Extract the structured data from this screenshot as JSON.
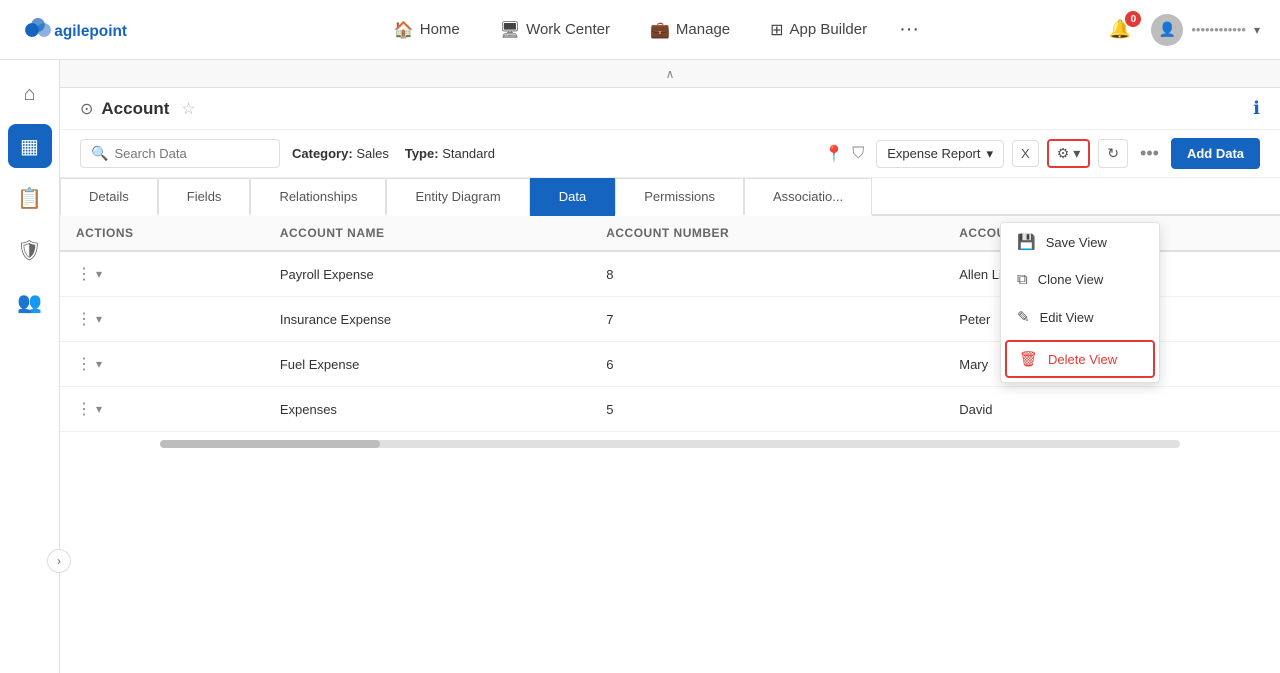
{
  "logo": {
    "alt": "AgilePoint"
  },
  "nav": {
    "items": [
      {
        "id": "home",
        "label": "Home",
        "icon": "🏠"
      },
      {
        "id": "work-center",
        "label": "Work Center",
        "icon": "🖥"
      },
      {
        "id": "manage",
        "label": "Manage",
        "icon": "💼"
      },
      {
        "id": "app-builder",
        "label": "App Builder",
        "icon": "⊞"
      }
    ],
    "more_icon": "···",
    "notification_count": "0",
    "user_name": "••••••••••••"
  },
  "sidebar": {
    "items": [
      {
        "id": "home",
        "icon": "⌂",
        "active": false
      },
      {
        "id": "data",
        "icon": "▦",
        "active": true
      },
      {
        "id": "reports",
        "icon": "📋",
        "active": false
      },
      {
        "id": "shield",
        "icon": "🛡",
        "active": false
      },
      {
        "id": "users",
        "icon": "👥",
        "active": false
      }
    ]
  },
  "page": {
    "back_label": "⊙",
    "title": "Account",
    "info_icon": "ℹ"
  },
  "toolbar": {
    "search_placeholder": "Search Data",
    "category_label": "Category:",
    "category_value": "Sales",
    "type_label": "Type:",
    "type_value": "Standard",
    "view_name": "Expense Report",
    "add_data_label": "Add Data"
  },
  "tabs": [
    {
      "id": "details",
      "label": "Details",
      "active": false
    },
    {
      "id": "fields",
      "label": "Fields",
      "active": false
    },
    {
      "id": "relationships",
      "label": "Relationships",
      "active": false
    },
    {
      "id": "entity-diagram",
      "label": "Entity Diagram",
      "active": false
    },
    {
      "id": "data",
      "label": "Data",
      "active": true
    },
    {
      "id": "permissions",
      "label": "Permissions",
      "active": false
    },
    {
      "id": "associations",
      "label": "Associatio...",
      "active": false
    }
  ],
  "table": {
    "columns": [
      {
        "id": "actions",
        "label": "ACTIONS"
      },
      {
        "id": "account-name",
        "label": "Account Name"
      },
      {
        "id": "account-number",
        "label": "Account Number"
      },
      {
        "id": "account-owner",
        "label": "Account Owner"
      }
    ],
    "rows": [
      {
        "id": 1,
        "account_name": "Payroll Expense",
        "account_number": "8",
        "account_owner": "Allen Lilly"
      },
      {
        "id": 2,
        "account_name": "Insurance Expense",
        "account_number": "7",
        "account_owner": "Peter"
      },
      {
        "id": 3,
        "account_name": "Fuel Expense",
        "account_number": "6",
        "account_owner": "Mary"
      },
      {
        "id": 4,
        "account_name": "Expenses",
        "account_number": "5",
        "account_owner": "David"
      }
    ]
  },
  "dropdown_menu": {
    "items": [
      {
        "id": "save-view",
        "label": "Save View",
        "icon": "💾"
      },
      {
        "id": "clone-view",
        "label": "Clone View",
        "icon": "⧉"
      },
      {
        "id": "edit-view",
        "label": "Edit View",
        "icon": "✎"
      },
      {
        "id": "delete-view",
        "label": "Delete View",
        "icon": "🗑",
        "danger": true
      }
    ]
  },
  "colors": {
    "primary": "#1565c0",
    "danger": "#e53935",
    "border": "#e0e0e0"
  }
}
